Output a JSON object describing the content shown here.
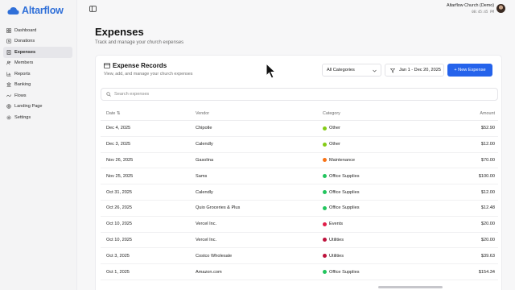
{
  "app": {
    "logo_text": "Altarflow",
    "accent": "#2563eb"
  },
  "sidebar": {
    "items": [
      {
        "label": "Dashboard",
        "icon": "dashboard-icon",
        "active": false
      },
      {
        "label": "Donations",
        "icon": "dollar-icon",
        "active": false
      },
      {
        "label": "Expenses",
        "icon": "receipt-icon",
        "active": true
      },
      {
        "label": "Members",
        "icon": "users-icon",
        "active": false
      },
      {
        "label": "Reports",
        "icon": "chart-icon",
        "active": false
      },
      {
        "label": "Banking",
        "icon": "bank-icon",
        "active": false
      },
      {
        "label": "Flows",
        "icon": "flow-icon",
        "active": false
      },
      {
        "label": "Landing Page",
        "icon": "globe-icon",
        "active": false
      },
      {
        "label": "Settings",
        "icon": "gear-icon",
        "active": false
      }
    ]
  },
  "user": {
    "name": "Altarflow Church (Demo)",
    "time": "08:45:45 PM"
  },
  "page": {
    "title": "Expenses",
    "subtitle": "Track and manage your church expenses"
  },
  "records": {
    "title": "Expense Records",
    "subtitle": "View, add, and manage your church expenses",
    "category_select": "All Categories",
    "date_range": "Jan 1 - Dec 20, 2025",
    "new_button": "+ New Expense",
    "search_placeholder": "Search expenses"
  },
  "table": {
    "columns": {
      "date": "Date ⇅",
      "vendor": "Vendor",
      "category": "Category",
      "amount": "Amount"
    },
    "rows": [
      {
        "date": "Dec 4, 2025",
        "vendor": "Chipotle",
        "category": "Other",
        "color": "#84cc16",
        "amount": "$52.90"
      },
      {
        "date": "Dec 3, 2025",
        "vendor": "Calendly",
        "category": "Other",
        "color": "#84cc16",
        "amount": "$12.00"
      },
      {
        "date": "Nov 26, 2025",
        "vendor": "Gasolina",
        "category": "Maintenance",
        "color": "#f97316",
        "amount": "$70.00"
      },
      {
        "date": "Nov 25, 2025",
        "vendor": "Sams",
        "category": "Office Supplies",
        "color": "#22c55e",
        "amount": "$100.00"
      },
      {
        "date": "Oct 31, 2025",
        "vendor": "Calendly",
        "category": "Office Supplies",
        "color": "#22c55e",
        "amount": "$12.00"
      },
      {
        "date": "Oct 26, 2025",
        "vendor": "Quio Groceries & Plus",
        "category": "Office Supplies",
        "color": "#22c55e",
        "amount": "$12.48"
      },
      {
        "date": "Oct 10, 2025",
        "vendor": "Vercel Inc.",
        "category": "Events",
        "color": "#e11d48",
        "amount": "$20.00"
      },
      {
        "date": "Oct 10, 2025",
        "vendor": "Vercel Inc.",
        "category": "Utilities",
        "color": "#be123c",
        "amount": "$20.00"
      },
      {
        "date": "Oct 3, 2025",
        "vendor": "Costco Wholesale",
        "category": "Utilities",
        "color": "#be123c",
        "amount": "$39.63"
      },
      {
        "date": "Oct 1, 2025",
        "vendor": "Amazon.com",
        "category": "Office Supplies",
        "color": "#22c55e",
        "amount": "$154.34"
      }
    ]
  }
}
